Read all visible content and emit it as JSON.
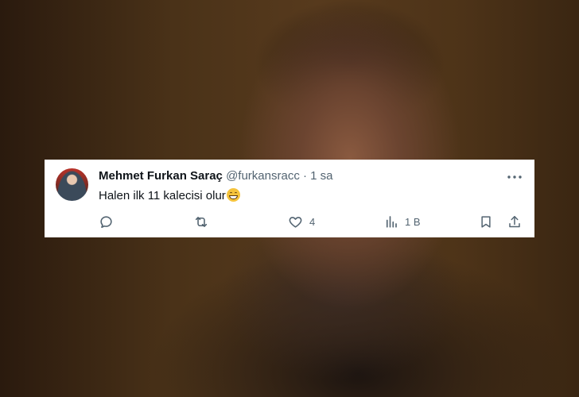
{
  "tweet": {
    "author_name": "Mehmet Furkan Saraç",
    "handle": "@furkansracc",
    "separator": "·",
    "time": "1 sa",
    "text": "Halen ilk 11 kalecisi olur",
    "emoji": "grinning-face-with-smiling-eyes",
    "likes": "4",
    "views": "1 B"
  },
  "icons": {
    "reply": "reply-icon",
    "retweet": "retweet-icon",
    "like": "heart-icon",
    "views": "analytics-icon",
    "bookmark": "bookmark-icon",
    "share": "share-icon",
    "more": "more-icon"
  },
  "colors": {
    "text_primary": "#0f1419",
    "text_secondary": "#536471",
    "card_bg": "#ffffff"
  }
}
